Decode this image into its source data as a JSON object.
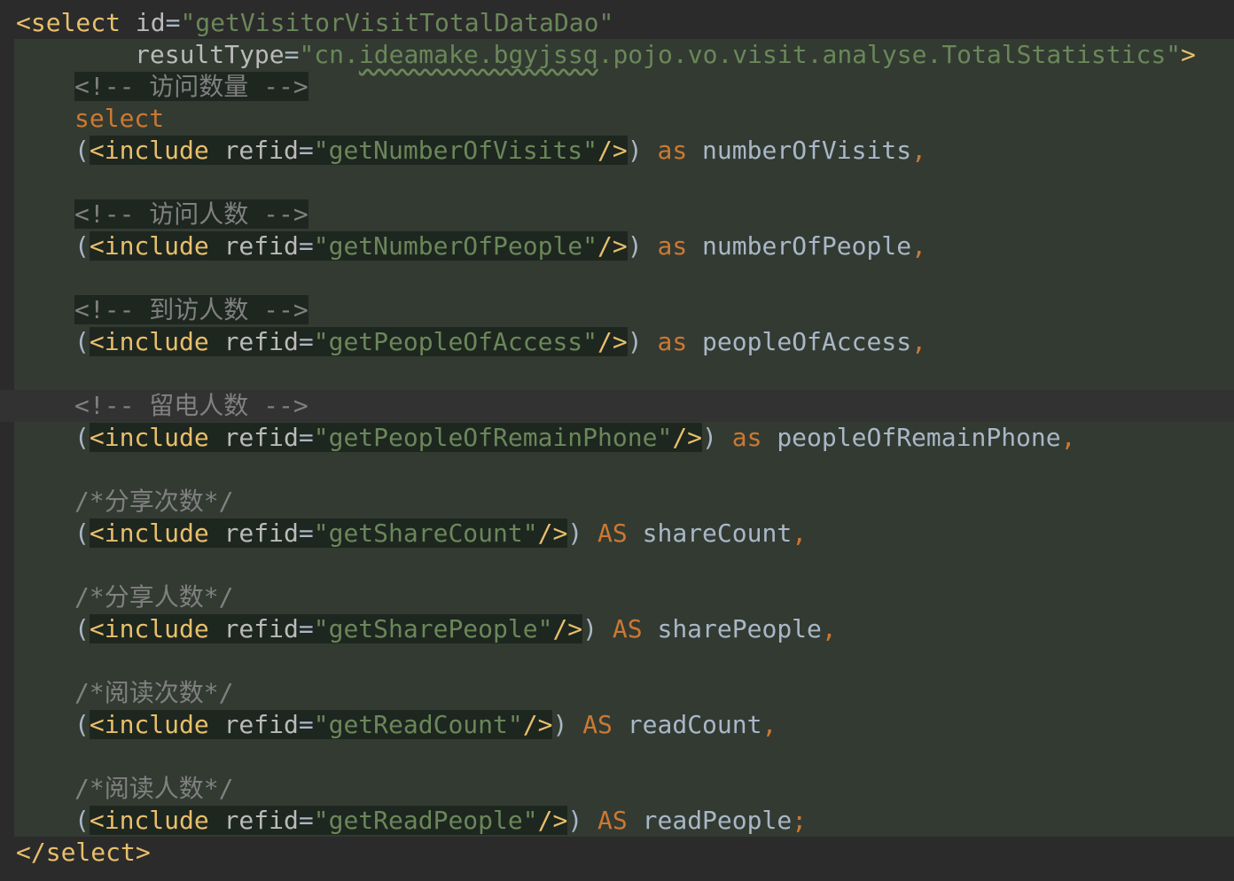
{
  "code": {
    "select_open_lt": "<",
    "select_tag": "select",
    "id_attr": "id",
    "eq": "=",
    "id_value": "\"getVisitorVisitTotalDataDao\"",
    "resultType_attr": "resultType",
    "resultType_val_prefix": "\"cn.",
    "resultType_val_squiggle": "ideamake.bgyjssq",
    "resultType_val_suffix": ".pojo.vo.visit.analyse.TotalStatistics\"",
    "tag_close": ">",
    "comment_visits": "<!-- 访问数量 -->",
    "sql_select": "select",
    "paren_open": "(",
    "paren_close": ")",
    "include_open": "<include",
    "refid_attr": "refid",
    "include_close": "/>",
    "kw_as": "as",
    "kw_AS": "AS",
    "comma": ",",
    "semicolon": ";",
    "ref_visits": "\"getNumberOfVisits\"",
    "alias_visits": "numberOfVisits",
    "comment_people": "<!-- 访问人数 -->",
    "ref_people": "\"getNumberOfPeople\"",
    "alias_people": "numberOfPeople",
    "comment_access": "<!-- 到访人数 -->",
    "ref_access": "\"getPeopleOfAccess\"",
    "alias_access": "peopleOfAccess",
    "comment_remain": "<!-- 留电人数 -->",
    "ref_remain": "\"getPeopleOfRemainPhone\"",
    "alias_remain": "peopleOfRemainPhone",
    "comment_share_count": "/*分享次数*/",
    "ref_share_count": "\"getShareCount\"",
    "alias_share_count": "shareCount",
    "comment_share_people": "/*分享人数*/",
    "ref_share_people": "\"getSharePeople\"",
    "alias_share_people": "sharePeople",
    "comment_read_count": "/*阅读次数*/",
    "ref_read_count": "\"getReadCount\"",
    "alias_read_count": "readCount",
    "comment_read_people": "/*阅读人数*/",
    "ref_read_people": "\"getReadPeople\"",
    "alias_read_people": "readPeople",
    "select_close": "</select>"
  },
  "colors": {
    "background": "#2b2b2b",
    "tag": "#e8bf6a",
    "attribute": "#bababa",
    "string": "#6a8759",
    "keyword": "#cc7832",
    "comment": "#808080",
    "identifier": "#a9b7c6"
  }
}
